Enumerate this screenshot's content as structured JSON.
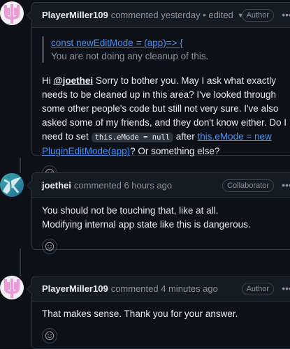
{
  "comments": [
    {
      "author": "PlayerMiller109",
      "meta": "commented yesterday • edited",
      "role": "Author",
      "quote": {
        "link": "const newEditMode = (app)=> {",
        "text": "You are not doing any cleanup of this."
      },
      "body": {
        "p1_pre": "Hi ",
        "mention": "@joethei",
        "p1_post": " Sorry to bother you. May I ask what exactly needs to be cleaned up in this area? I've looked through some other people's code but still not very sure. I've also asked some of my friends, and they don't know either. Do I need to set ",
        "code": "this.eMode = null",
        "p1_after_code": " after ",
        "link": "this.eMode = new PluginEditMode(app)",
        "p1_end": "? Or something else?"
      }
    },
    {
      "author": "joethei",
      "meta": "commented 6 hours ago",
      "role": "Collaborator",
      "line1": "You should not be touching that, like at all.",
      "line2": "Modifying internal app state like this is dangerous."
    },
    {
      "author": "PlayerMiller109",
      "meta": "commented 4 minutes ago",
      "role": "Author",
      "line1": "That makes sense. Thank you for your answer."
    }
  ],
  "icons": {
    "menu": "kebab-horizontal-icon",
    "reaction": "smiley-icon",
    "edited_dropdown": "triangle-down-icon"
  },
  "colors": {
    "background": "#0d1117",
    "header": "#161b22",
    "border": "#30363d",
    "link": "#4493f8",
    "muted": "#8b949e",
    "avatar_pink": "#e89bd5"
  }
}
